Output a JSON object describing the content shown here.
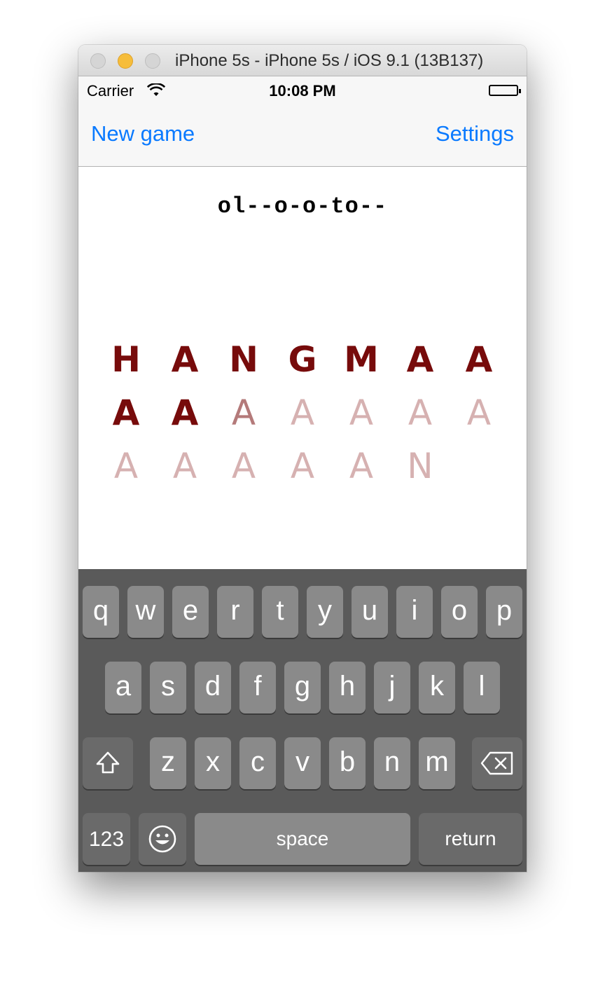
{
  "window": {
    "title": "iPhone 5s - iPhone 5s / iOS 9.1 (13B137)"
  },
  "status": {
    "carrier": "Carrier",
    "time": "10:08 PM"
  },
  "nav": {
    "left": "New game",
    "right": "Settings"
  },
  "game": {
    "puzzle": "ol--o-o-to--",
    "rows": [
      [
        "H",
        "A",
        "N",
        "G",
        "M",
        "A",
        "A"
      ],
      [
        "A",
        "A",
        "A",
        "A",
        "A",
        "A",
        "A"
      ],
      [
        "A",
        "A",
        "A",
        "A",
        "A",
        "N"
      ]
    ]
  },
  "keyboard": {
    "row1": [
      "q",
      "w",
      "e",
      "r",
      "t",
      "y",
      "u",
      "i",
      "o",
      "p"
    ],
    "row2": [
      "a",
      "s",
      "d",
      "f",
      "g",
      "h",
      "j",
      "k",
      "l"
    ],
    "row3": [
      "z",
      "x",
      "c",
      "v",
      "b",
      "n",
      "m"
    ],
    "numbers": "123",
    "space": "space",
    "return": "return"
  },
  "icons": {
    "shift": "shift-icon",
    "delete": "delete-icon",
    "emoji": "emoji-icon",
    "wifi": "wifi-icon",
    "battery": "battery-icon"
  },
  "colors": {
    "accent": "#0a7aff",
    "letter_full": "#770b0b",
    "letter_mid": "#b47a7a",
    "letter_faint": "#d6b1b1",
    "keyboard_bg": "#5a5a5a",
    "key": "#8a8a8a"
  }
}
